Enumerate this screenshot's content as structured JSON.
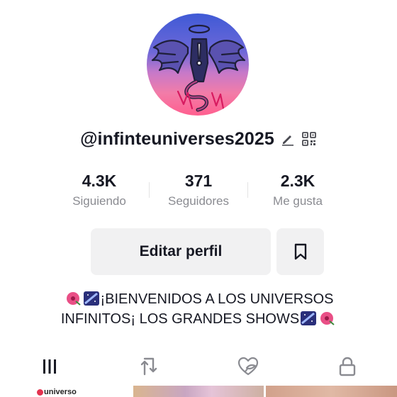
{
  "profile": {
    "username": "@infinteuniverses2025",
    "avatar_icon": "winged-figure-avatar"
  },
  "stats": [
    {
      "value": "4.3K",
      "label": "Siguiendo"
    },
    {
      "value": "371",
      "label": "Seguidores"
    },
    {
      "value": "2.3K",
      "label": "Me gusta"
    }
  ],
  "actions": {
    "edit_label": "Editar perfil",
    "bookmark_icon": "bookmark-icon"
  },
  "bio": {
    "line1": "¡BIENVENIDOS A LOS UNIVERSOS",
    "line2": "INFINITOS¡ LOS GRANDES SHOWS"
  },
  "tabs": [
    {
      "icon": "grid-icon",
      "active": true
    },
    {
      "icon": "repost-icon",
      "active": false
    },
    {
      "icon": "liked-icon",
      "active": false
    },
    {
      "icon": "lock-icon",
      "active": false
    }
  ],
  "thumbnails": [
    {
      "caption": "universo"
    },
    {
      "caption": ""
    },
    {
      "caption": ""
    }
  ],
  "colors": {
    "text": "#161823",
    "secondary_text": "#8a8b91",
    "button_bg": "#f1f1f2"
  }
}
